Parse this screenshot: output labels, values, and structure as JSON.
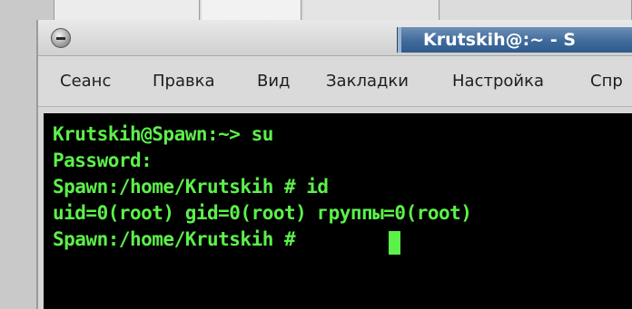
{
  "window": {
    "title": "Krutskih@:~ - S"
  },
  "menubar": {
    "items": [
      "Сеанс",
      "Правка",
      "Вид",
      "Закладки",
      "Настройка",
      "Спр"
    ]
  },
  "terminal": {
    "lines": [
      "Krutskih@Spawn:~> su",
      "Password:",
      "Spawn:/home/Krutskih # id",
      "uid=0(root) gid=0(root) группы=0(root)",
      "Spawn:/home/Krutskih # "
    ],
    "text_color": "#5cf04a",
    "background": "#000000"
  },
  "colors": {
    "title_active": "#3f6a9c",
    "menubar": "#dadada"
  },
  "icons": {
    "window_menu": "window-menu-icon"
  }
}
